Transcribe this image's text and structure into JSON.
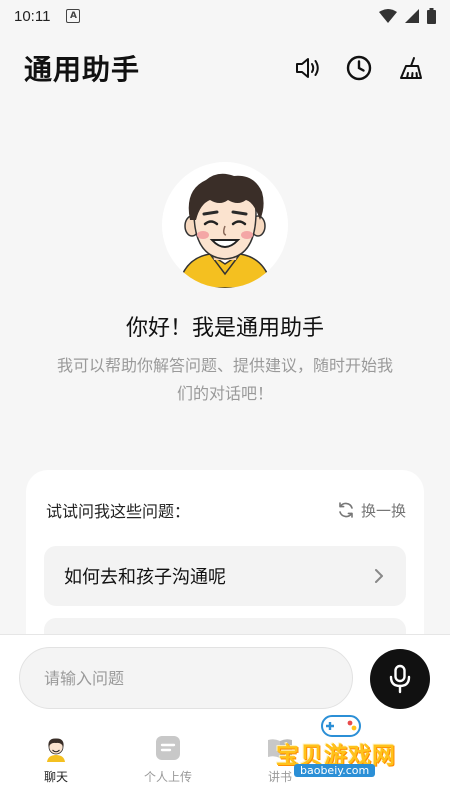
{
  "status_bar": {
    "time": "10:11",
    "notif_letter": "A"
  },
  "header": {
    "title": "通用助手",
    "icons": [
      "speaker-icon",
      "clock-icon",
      "broom-icon"
    ]
  },
  "welcome": {
    "greeting": "你好！我是通用助手",
    "intro": "我可以帮助你解答问题、提供建议，随时开始我们的对话吧！"
  },
  "suggestions": {
    "title": "试试问我这些问题：",
    "refresh_label": "换一换",
    "items": [
      "如何去和孩子沟通呢",
      ""
    ]
  },
  "input": {
    "placeholder": "请输入问题"
  },
  "nav": {
    "items": [
      {
        "label": "聊天",
        "active": true
      },
      {
        "label": "个人上传",
        "active": false
      },
      {
        "label": "讲书",
        "active": false
      }
    ]
  },
  "watermark": {
    "text": "宝贝游戏网",
    "url": "baobeiy.com"
  },
  "colors": {
    "accent": "#111111",
    "card": "#ffffff",
    "background": "#f6f6f6",
    "watermark": "#ffc21a"
  }
}
